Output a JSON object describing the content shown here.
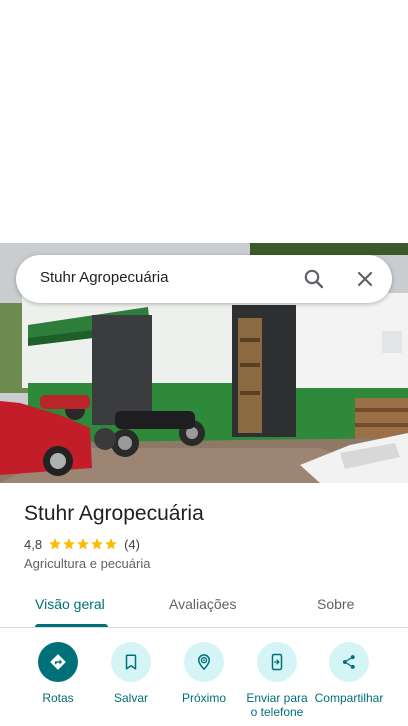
{
  "search": {
    "query": "Stuhr Agropecuária"
  },
  "place": {
    "name": "Stuhr Agropecuária",
    "rating": "4,8",
    "review_count": "(4)",
    "stars": 5,
    "category": "Agricultura e pecuária"
  },
  "tabs": [
    {
      "label": "Visão geral",
      "active": true
    },
    {
      "label": "Avaliações",
      "active": false
    },
    {
      "label": "Sobre",
      "active": false
    }
  ],
  "actions": [
    {
      "label": "Rotas",
      "icon": "directions-icon"
    },
    {
      "label": "Salvar",
      "icon": "bookmark-icon"
    },
    {
      "label": "Próximo",
      "icon": "nearby-icon"
    },
    {
      "label": "Enviar para o telefone",
      "icon": "send-to-phone-icon"
    },
    {
      "label": "Compartilhar",
      "icon": "share-icon"
    }
  ],
  "colors": {
    "accent": "#00707a",
    "accent_light": "#d5f4f6",
    "star": "#fbbc04"
  }
}
